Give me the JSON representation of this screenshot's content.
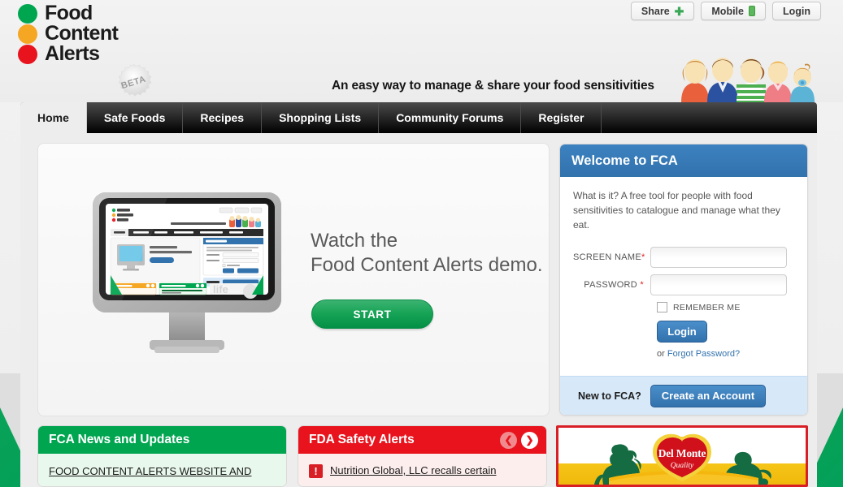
{
  "brand": {
    "words": [
      "Food",
      "Content",
      "Alerts"
    ],
    "dot_colors": [
      "#00a550",
      "#f5a623",
      "#e8131d"
    ],
    "beta_label": "BETA"
  },
  "header": {
    "tagline": "An easy way to manage & share your food sensitivities",
    "top_buttons": [
      {
        "label": "Share",
        "icon": "plus-icon"
      },
      {
        "label": "Mobile",
        "icon": "phone-icon"
      },
      {
        "label": "Login",
        "icon": ""
      }
    ],
    "people_illustration": "family-group-icon"
  },
  "nav": {
    "items": [
      {
        "label": "Home",
        "active": true
      },
      {
        "label": "Safe Foods",
        "active": false
      },
      {
        "label": "Recipes",
        "active": false
      },
      {
        "label": "Shopping Lists",
        "active": false
      },
      {
        "label": "Community Forums",
        "active": false
      },
      {
        "label": "Register",
        "active": false
      }
    ]
  },
  "hero": {
    "heading_line1": "Watch the",
    "heading_line2": "Food Content Alerts demo.",
    "start_label": "START",
    "monitor_icon": "desktop-monitor-icon"
  },
  "welcome": {
    "title": "Welcome to FCA",
    "description": "What is it? A free tool for people with food sensitivities to catalogue and manage what they eat.",
    "fields": [
      {
        "label": "SCREEN NAME",
        "required": "*",
        "value": "",
        "placeholder": ""
      },
      {
        "label": "PASSWORD",
        "required": "*",
        "value": "",
        "placeholder": ""
      }
    ],
    "remember_label": "REMEMBER ME",
    "remember_checked": false,
    "login_label": "Login",
    "forgot_prefix": "or ",
    "forgot_label": "Forgot Password?",
    "newto_label": "New to FCA?",
    "create_label": "Create an Account",
    "header_color": "#3272ad",
    "newto_bg": "#d7e8f8"
  },
  "panels": {
    "news": {
      "title": "FCA News and Updates",
      "headline": "FOOD CONTENT ALERTS WEBSITE AND",
      "color": "#00a550"
    },
    "fda": {
      "title": "FDA Safety Alerts",
      "headline": "Nutrition Global, LLC recalls certain",
      "color": "#e8131d",
      "prev_icon": "chevron-left-icon",
      "next_icon": "chevron-right-icon",
      "alert_icon": "exclamation-icon"
    },
    "ad": {
      "brand": "Del Monte",
      "tagline": "Quality",
      "border_color": "#d91f26"
    }
  }
}
